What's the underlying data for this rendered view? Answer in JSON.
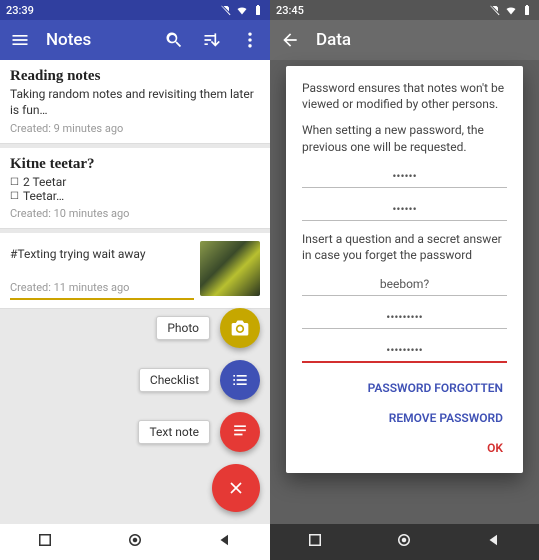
{
  "left": {
    "status_time": "23:39",
    "app_title": "Notes",
    "notes": [
      {
        "title": "Reading notes",
        "body": "Taking random notes and revisiting them later is fun…",
        "created": "Created: 9 minutes ago"
      },
      {
        "title": "Kitne teetar?",
        "check1": "2 Teetar",
        "check2": "Teetar…",
        "created": "Created: 10 minutes ago"
      },
      {
        "body": "#Texting trying wait away",
        "created": "Created: 11 minutes ago"
      }
    ],
    "fab": {
      "photo": "Photo",
      "checklist": "Checklist",
      "textnote": "Text note"
    }
  },
  "right": {
    "status_time": "23:45",
    "app_title": "Data",
    "dialog": {
      "p1": "Password ensures that notes won't be viewed or modified by other persons.",
      "p2": "When setting a new password, the previous one will be requested.",
      "pw1": "••••••",
      "pw2": "••••••",
      "p3": "Insert a question and a secret answer in case you forget the password",
      "question": "beebom?",
      "ans1": "•••••••••",
      "ans2": "•••••••••",
      "forgotten": "PASSWORD FORGOTTEN",
      "remove": "REMOVE PASSWORD",
      "ok": "OK"
    }
  }
}
